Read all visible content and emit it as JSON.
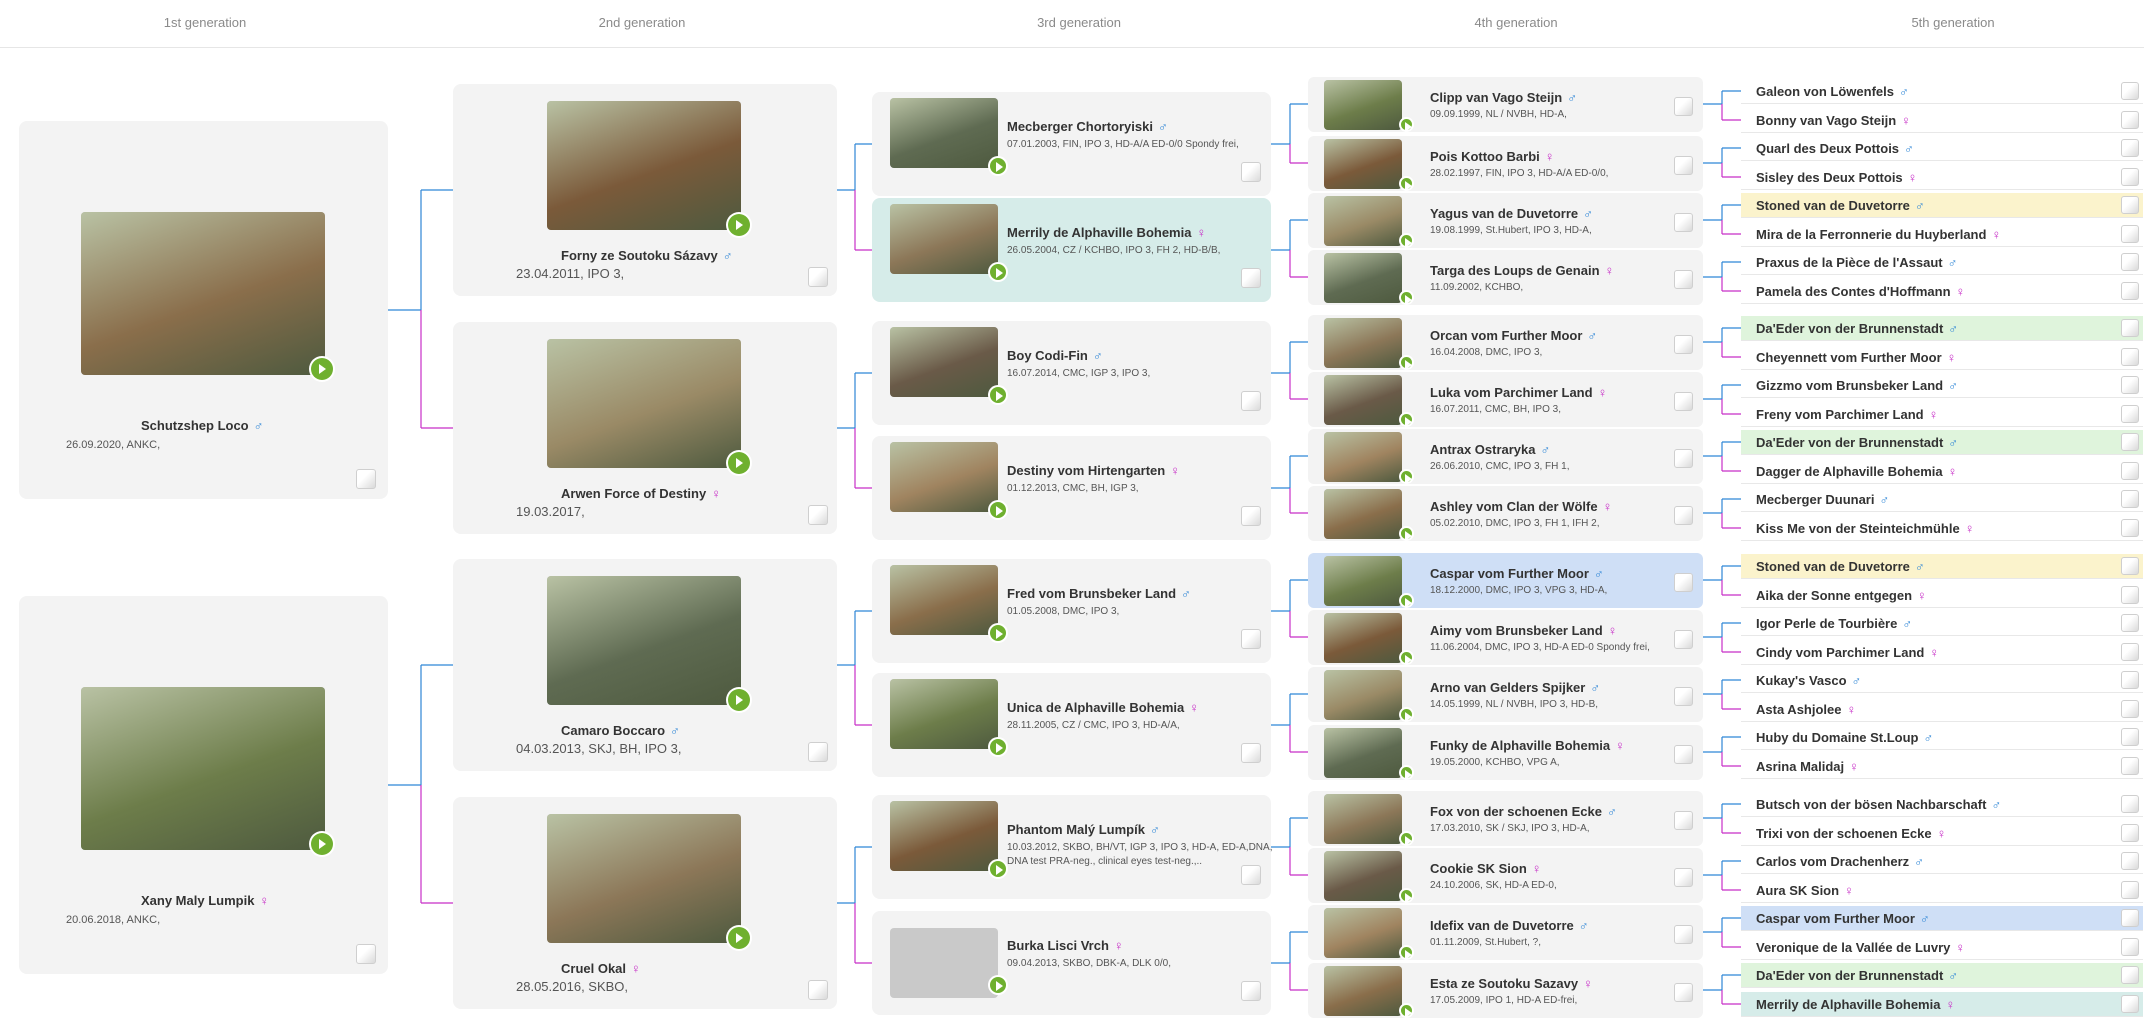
{
  "header": {
    "generations": [
      "1st generation",
      "2nd generation",
      "3rd generation",
      "4th generation",
      "5th generation"
    ]
  },
  "colors": {
    "male_line": "#2f86d6",
    "female_line": "#c72fc7",
    "video_button": "#6fb02f",
    "highlight_yellow": "#fbf3cc",
    "highlight_green": "#dff4dc",
    "highlight_blue": "#cfdff6",
    "highlight_teal": "#d6ece9"
  },
  "gen1": [
    {
      "name": "Schutzshep Loco",
      "sex": "♂",
      "info": "26.09.2020, ANKC,",
      "logo": "ankc-logo"
    },
    {
      "name": "Xany Maly Lumpik",
      "sex": "♀",
      "info": "20.06.2018, ANKC,",
      "logo": "kc-logo"
    }
  ],
  "gen2": [
    {
      "name": "Forny ze Soutoku Sázavy",
      "sex": "♂",
      "info": "23.04.2011, IPO 3,",
      "logo": "flag-logo"
    },
    {
      "name": "Arwen Force of Destiny",
      "sex": "♀",
      "info": "19.03.2017,",
      "logo": "flag-logo"
    },
    {
      "name": "Camaro Boccaro",
      "sex": "♂",
      "info": "04.03.2013, SKJ, BH, IPO 3,",
      "logo": "flag-logo"
    },
    {
      "name": "Cruel Okal",
      "sex": "♀",
      "info": "28.05.2016, SKBO,",
      "logo": "kc-logo"
    }
  ],
  "gen3": [
    {
      "name": "Mecberger Chortoryiski",
      "sex": "♂",
      "info": [
        "07.01.2003, FIN, IPO 3, HD-A/A ED-0/0 Spondy frei,"
      ],
      "logo": "sv-logo"
    },
    {
      "name": "Merrily de Alphaville Bohemia",
      "sex": "♀",
      "info": [
        "26.05.2004, CZ / KCHBO, IPO 3, FH 2, HD-B/B,"
      ],
      "logo": "flag-logo",
      "highlight": "teal"
    },
    {
      "name": "Boy Codi-Fin",
      "sex": "♂",
      "info": [
        "16.07.2014, CMC, IGP 3, IPO 3,"
      ],
      "logo": "flag-logo"
    },
    {
      "name": "Destiny vom Hirtengarten",
      "sex": "♀",
      "info": [
        "01.12.2013, CMC, BH, IGP 3,"
      ],
      "logo": "dmc-logo"
    },
    {
      "name": "Fred vom Brunsbeker Land",
      "sex": "♂",
      "info": [
        "01.05.2008, DMC, IPO 3,"
      ],
      "logo": "dmc-logo"
    },
    {
      "name": "Unica de Alphaville Bohemia",
      "sex": "♀",
      "info": [
        "28.11.2005, CZ / CMC, IPO 3, HD-A/A,"
      ],
      "logo": "flag-logo"
    },
    {
      "name": "Phantom Malý Lumpík",
      "sex": "♂",
      "info": [
        "10.03.2012, SKBO, BH/VT, IGP 3, IPO 3, HD-A, ED-A,DNA,",
        "DNA test PRA-neg., clinical eyes test-neg.,.."
      ],
      "logo": "kc-logo"
    },
    {
      "name": "Burka Lisci Vrch",
      "sex": "♀",
      "info": [
        "09.04.2013, SKBO, DBK-A, DLK 0/0,"
      ],
      "logo": "kc-logo",
      "placeholder": true
    }
  ],
  "gen4": [
    {
      "name": "Clipp van Vago Steijn",
      "sex": "♂",
      "info": "09.09.1999, NL / NVBH, HD-A,",
      "logo": "nvbh-logo"
    },
    {
      "name": "Pois Kottoo Barbi",
      "sex": "♀",
      "info": "28.02.1997, FIN, IPO 3, HD-A/A ED-0/0,",
      "logo": "sv-logo"
    },
    {
      "name": "Yagus van de Duvetorre",
      "sex": "♂",
      "info": "19.08.1999, St.Hubert, IPO 3, HD-A,",
      "logo": "sh-logo"
    },
    {
      "name": "Targa des Loups de Genain",
      "sex": "♀",
      "info": "11.09.2002, KCHBO,",
      "logo": "scc-logo"
    },
    {
      "name": "Orcan vom Further Moor",
      "sex": "♂",
      "info": "16.04.2008, DMC, IPO 3,",
      "logo": "dmc-logo"
    },
    {
      "name": "Luka vom Parchimer Land",
      "sex": "♀",
      "info": "16.07.2011, CMC, BH, IPO 3,",
      "logo": "dmc-logo"
    },
    {
      "name": "Antrax Ostraryka",
      "sex": "♂",
      "info": "26.06.2010, CMC, IPO 3, FH 1,",
      "logo": "flag-logo"
    },
    {
      "name": "Ashley vom Clan der Wölfe",
      "sex": "♀",
      "info": "05.02.2010, DMC, IPO 3, FH 1, IFH 2,",
      "logo": "dmc-logo"
    },
    {
      "name": "Caspar vom Further Moor",
      "sex": "♂",
      "info": "18.12.2000, DMC, IPO 3, VPG 3, HD-A,",
      "logo": "dmc-logo",
      "highlight": "blue"
    },
    {
      "name": "Aimy vom Brunsbeker Land",
      "sex": "♀",
      "info": "11.06.2004, DMC, IPO 3, HD-A ED-0 Spondy frei,",
      "logo": "dmc-logo"
    },
    {
      "name": "Arno van Gelders Spijker",
      "sex": "♂",
      "info": "14.05.1999, NL / NVBH, IPO 3, HD-B,",
      "logo": "nvbh-logo"
    },
    {
      "name": "Funky de Alphaville Bohemia",
      "sex": "♀",
      "info": "19.05.2000, KCHBO, VPG A,",
      "logo": "flag-logo"
    },
    {
      "name": "Fox von der schoenen Ecke",
      "sex": "♂",
      "info": "17.03.2010, SK / SKJ, IPO 3, HD-A,",
      "logo": "scc-logo"
    },
    {
      "name": "Cookie SK Sion",
      "sex": "♀",
      "info": "24.10.2006, SK, HD-A ED-0,",
      "logo": "kc-logo"
    },
    {
      "name": "Idefix van de Duvetorre",
      "sex": "♂",
      "info": "01.11.2009, St.Hubert, ?,",
      "logo": "sh-logo"
    },
    {
      "name": "Esta ze Soutoku Sazavy",
      "sex": "♀",
      "info": "17.05.2009, IPO 1, HD-A ED-frei,",
      "logo": "flag-logo"
    }
  ],
  "gen5": [
    {
      "name": "Galeon von Löwenfels",
      "sex": "♂",
      "logo": "dmc-logo"
    },
    {
      "name": "Bonny van Vago Steijn",
      "sex": "♀",
      "logo": "nvbh-logo"
    },
    {
      "name": "Quarl des Deux Pottois",
      "sex": "♂",
      "logo": "sh-logo"
    },
    {
      "name": "Sisley des Deux Pottois",
      "sex": "♀",
      "logo": "sh-logo"
    },
    {
      "name": "Stoned van de Duvetorre",
      "sex": "♂",
      "logo": "sh-logo",
      "highlight": "yellow"
    },
    {
      "name": "Mira de la Ferronnerie du Huyberland",
      "sex": "♀",
      "logo": "scc-logo"
    },
    {
      "name": "Praxus de la Pièce de l'Assaut",
      "sex": "♂",
      "logo": "scc-logo"
    },
    {
      "name": "Pamela des Contes d'Hoffmann",
      "sex": "♀",
      "logo": "scc-logo"
    },
    {
      "name": "Da'Eder von der Brunnenstadt",
      "sex": "♂",
      "logo": "dmc-logo",
      "highlight": "green"
    },
    {
      "name": "Cheyennett vom Further Moor",
      "sex": "♀",
      "logo": "dmc-logo"
    },
    {
      "name": "Gizzmo vom Brunsbeker Land",
      "sex": "♂",
      "logo": "dmc-logo"
    },
    {
      "name": "Freny vom Parchimer Land",
      "sex": "♀",
      "logo": "dmc-logo"
    },
    {
      "name": "Da'Eder von der Brunnenstadt",
      "sex": "♂",
      "logo": "dmc-logo",
      "highlight": "green"
    },
    {
      "name": "Dagger de Alphaville Bohemia",
      "sex": "♀",
      "logo": "flag-logo"
    },
    {
      "name": "Mecberger Duunari",
      "sex": "♂",
      "logo": "sv-logo"
    },
    {
      "name": "Kiss Me von der Steinteichmühle",
      "sex": "♀",
      "logo": "dmc-logo"
    },
    {
      "name": "Stoned van de Duvetorre",
      "sex": "♂",
      "logo": "sh-logo",
      "highlight": "yellow"
    },
    {
      "name": "Aika der Sonne entgegen",
      "sex": "♀",
      "logo": "dmc-logo"
    },
    {
      "name": "Igor Perle de Tourbière",
      "sex": "♂",
      "logo": "nvbh-logo"
    },
    {
      "name": "Cindy vom Parchimer Land",
      "sex": "♀",
      "logo": "dmc-logo"
    },
    {
      "name": "Kukay's Vasco",
      "sex": "♂",
      "logo": "sh-logo"
    },
    {
      "name": "Asta Ashjolee",
      "sex": "♀",
      "logo": "nvbh-logo"
    },
    {
      "name": "Huby du Domaine St.Loup",
      "sex": "♂",
      "logo": "scc-logo"
    },
    {
      "name": "Asrina Malidaj",
      "sex": "♀",
      "logo": "flag-logo"
    },
    {
      "name": "Butsch von der bösen Nachbarschaft",
      "sex": "♂",
      "logo": "dmc-logo"
    },
    {
      "name": "Trixi von der schoenen Ecke",
      "sex": "♀",
      "logo": "scc-logo"
    },
    {
      "name": "Carlos vom Drachenherz",
      "sex": "♂",
      "logo": "dmc-logo"
    },
    {
      "name": "Aura SK Sion",
      "sex": "♀",
      "logo": "kc-logo"
    },
    {
      "name": "Caspar vom Further Moor",
      "sex": "♂",
      "logo": "dmc-logo",
      "highlight": "blue"
    },
    {
      "name": "Veronique de la Vallée de Luvry",
      "sex": "♀",
      "logo": "scc-logo"
    },
    {
      "name": "Da'Eder von der Brunnenstadt",
      "sex": "♂",
      "logo": "dmc-logo",
      "highlight": "green"
    },
    {
      "name": "Merrily de Alphaville Bohemia",
      "sex": "♀",
      "logo": "flag-logo",
      "highlight": "teal"
    }
  ]
}
